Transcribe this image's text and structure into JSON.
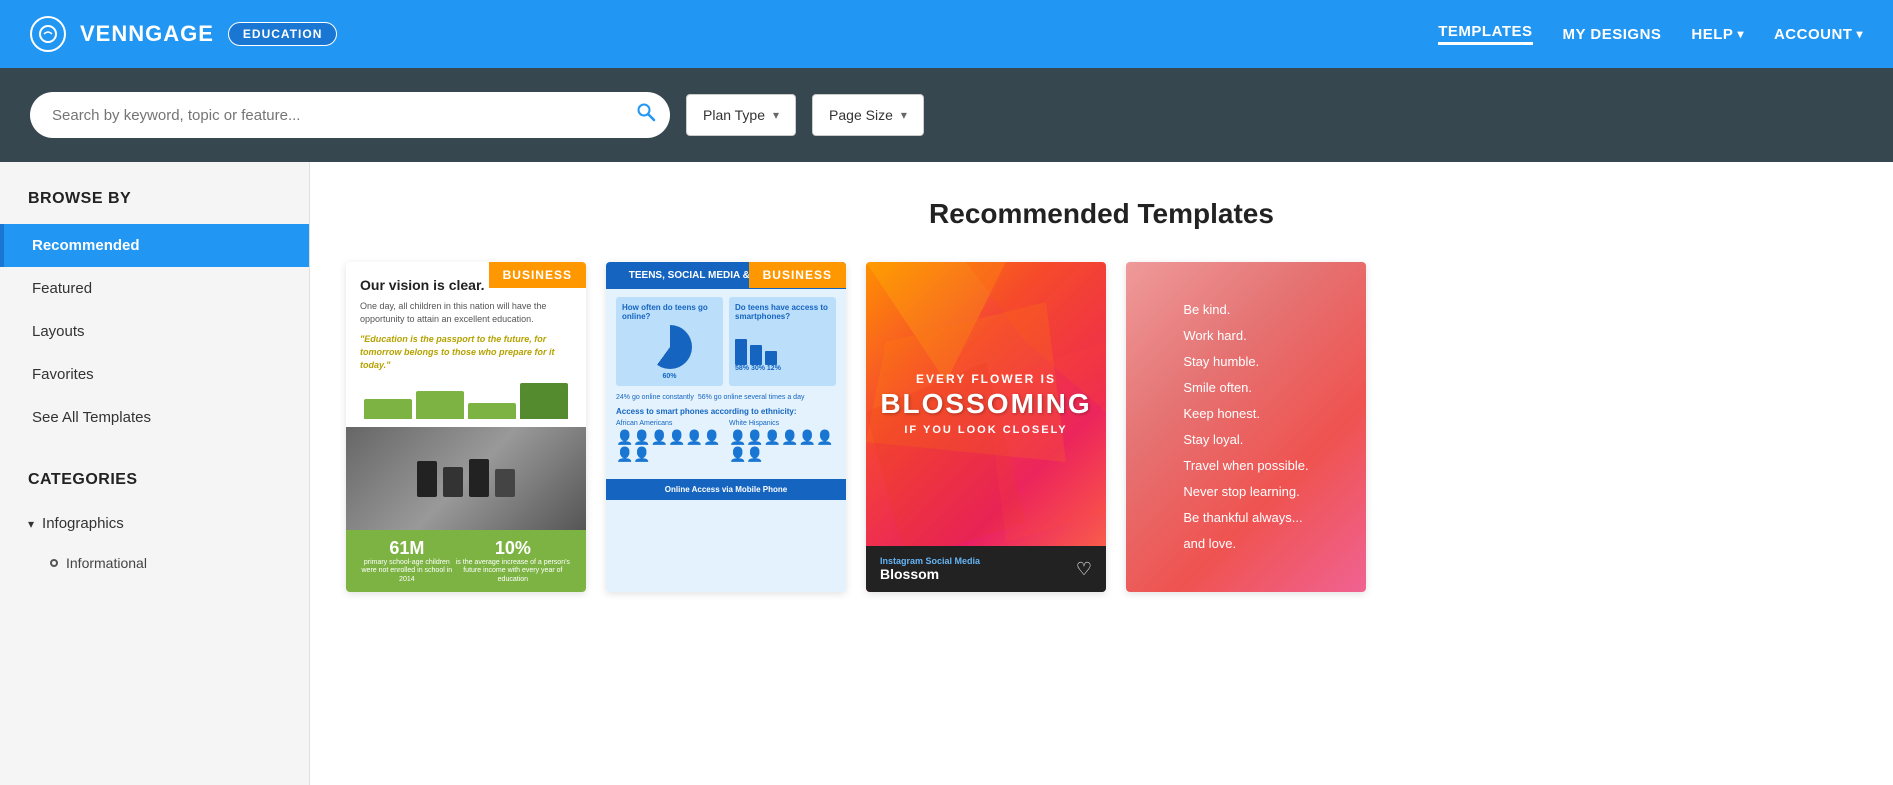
{
  "app": {
    "logo_text": "VENNGAGE",
    "edu_badge": "EDUCATION"
  },
  "nav": {
    "templates": "TEMPLATES",
    "my_designs": "MY DESIGNS",
    "help": "HELP",
    "account": "ACCOUNT"
  },
  "search": {
    "placeholder": "Search by keyword, topic or feature...",
    "plan_type_label": "Plan Type",
    "page_size_label": "Page Size"
  },
  "sidebar": {
    "browse_by_title": "BROWSE BY",
    "items": [
      {
        "label": "Recommended",
        "active": true
      },
      {
        "label": "Featured",
        "active": false
      },
      {
        "label": "Layouts",
        "active": false
      },
      {
        "label": "Favorites",
        "active": false
      },
      {
        "label": "See All Templates",
        "active": false
      }
    ],
    "categories_title": "CATEGORIES",
    "categories": [
      {
        "label": "Infographics",
        "expanded": true
      }
    ],
    "subcategories": [
      {
        "label": "Informational"
      }
    ]
  },
  "content": {
    "page_title": "Recommended Templates",
    "templates": [
      {
        "id": "card1",
        "badge": "BUSINESS",
        "headline": "Our vision is clear.",
        "subtext": "One day, all children in this nation will have the opportunity to attain an excellent education.",
        "quote": "\"Education is the passport to the future, for tomorrow belongs to those who prepare for it today.\"",
        "stat1_num": "61M",
        "stat1_label": "primary school-age children were not enrolled in school in 2014",
        "stat2_num": "10%",
        "stat2_label": "is the average increase of a person's future income with every year of education"
      },
      {
        "id": "card2",
        "badge": "BUSINESS",
        "header": "TEENS, SOCIAL MEDIA & TECHNOLOGY",
        "col1_title": "How often do teens go online?",
        "col2_title": "Do teens have access to smartphones?",
        "bottom_label": "Online Access via Mobile Phone"
      },
      {
        "id": "card3",
        "every": "EVERY FLOWER IS",
        "blossom": "BLOSSOMING",
        "subtitle": "IF YOU LOOK CLOSELY",
        "footer_label": "Instagram Social Media",
        "footer_title": "Blossom"
      },
      {
        "id": "card4",
        "quote_lines": [
          "Be kind.",
          "Work hard.",
          "Stay humble.",
          "Smile often.",
          "Keep honest.",
          "Stay loyal.",
          "Travel when possible.",
          "Never stop learning.",
          "Be thankful always...",
          "and love."
        ]
      }
    ]
  }
}
